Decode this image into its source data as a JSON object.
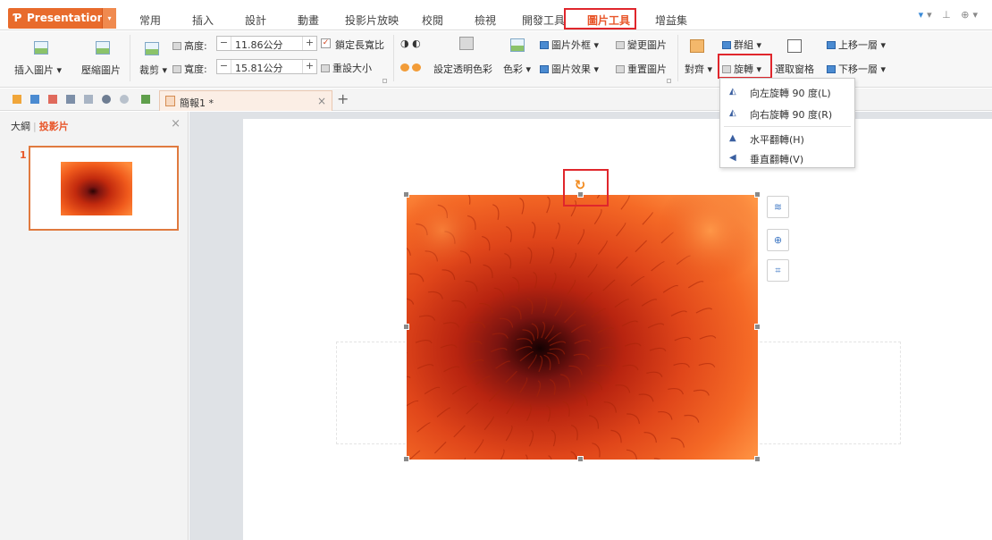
{
  "app": {
    "name": "Presentation",
    "p_glyph": "Ƥ",
    "drop_glyph": "▾"
  },
  "menu_tabs": [
    "常用",
    "插入",
    "設計",
    "動畫",
    "投影片放映",
    "校閱",
    "檢視",
    "開發工具",
    "圖片工具",
    "增益集"
  ],
  "active_tab": "圖片工具",
  "window_controls": "▾ ⊥ ⊕▾",
  "ribbon": {
    "insert_picture": "插入圖片 ▾",
    "compress_picture": "壓縮圖片",
    "crop": "裁剪 ▾",
    "height_label": "高度:",
    "height_value": "11.86公分",
    "width_label": "寬度:",
    "width_value": "15.81公分",
    "minus": "−",
    "plus": "+",
    "lock_aspect": "鎖定長寬比",
    "reset_size": "重設大小",
    "set_transparent_color": "設定透明色彩",
    "color": "色彩 ▾",
    "picture_border": "圖片外框 ▾",
    "picture_effects": "圖片效果 ▾",
    "change_picture": "變更圖片",
    "reset_picture": "重置圖片",
    "align": "對齊 ▾",
    "group": "群組 ▾",
    "rotate": "旋轉 ▾",
    "selection_pane": "選取窗格",
    "bring_forward": "上移一層 ▾",
    "send_backward": "下移一層 ▾"
  },
  "rotate_menu": [
    {
      "icon": "◭",
      "label": "向左旋轉 90 度(L)"
    },
    {
      "icon": "◭",
      "label": "向右旋轉 90 度(R)"
    },
    {
      "icon": "▲",
      "label": "水平翻轉(H)"
    },
    {
      "icon": "◀",
      "label": "垂直翻轉(V)"
    }
  ],
  "document_tab": {
    "name": "簡報1 *",
    "close": "×",
    "add": "+"
  },
  "left_panel": {
    "outline_tab": "大綱",
    "slides_tab": "投影片",
    "close": "×",
    "slide_number": "1"
  },
  "rotate_handle_glyph": "↻",
  "side_tools": {
    "layer": "≋",
    "zoom": "⊕",
    "crop": "⌗"
  },
  "colors": {
    "accent": "#e8562a",
    "highlight": "#e0262c",
    "flower_dark": "#7a1410",
    "flower_mid": "#d93a12",
    "flower_light": "#ff8a3a"
  }
}
